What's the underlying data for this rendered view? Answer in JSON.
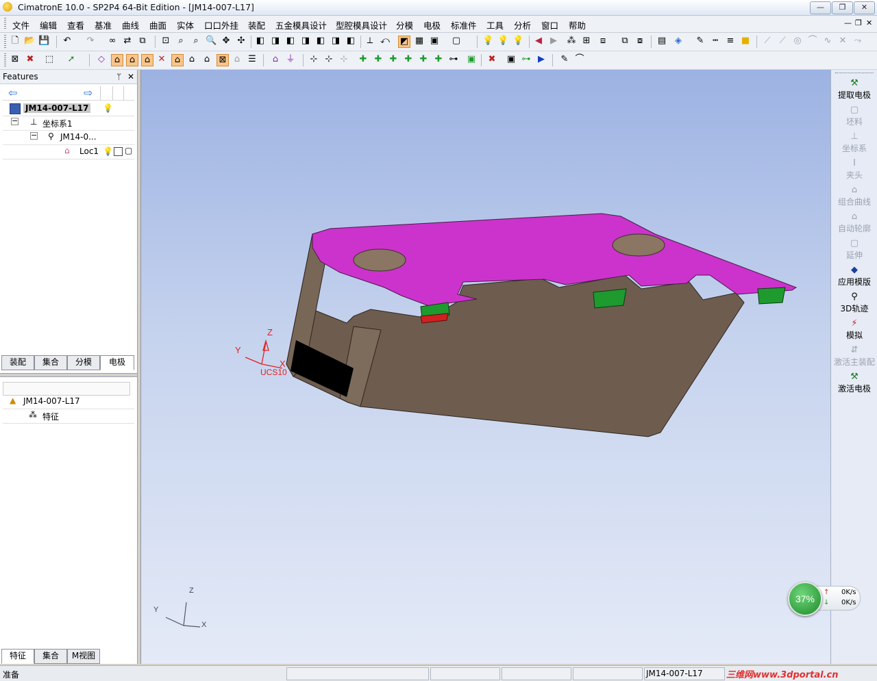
{
  "window": {
    "title": "CimatronE 10.0 - SP2P4 64-Bit Edition - [JM14-007-L17]",
    "minimize_glyph": "—",
    "restore_glyph": "❐",
    "close_glyph": "✕"
  },
  "menu": {
    "items": [
      "文件",
      "编辑",
      "查看",
      "基准",
      "曲线",
      "曲面",
      "实体",
      "口口外挂",
      "装配",
      "五金模具设计",
      "型腔模具设计",
      "分模",
      "电极",
      "标准件",
      "工具",
      "分析",
      "窗口",
      "帮助"
    ],
    "mdi_min": "—",
    "mdi_restore": "❐",
    "mdi_close": "✕"
  },
  "features_panel": {
    "title": "Features",
    "pin_glyph": "ᛘ",
    "close_glyph": "✕",
    "tree": [
      {
        "label": "JM14-007-L17",
        "expander": "",
        "icon": "part-icon"
      },
      {
        "label": "坐标系1",
        "expander": "−",
        "icon": "axes-icon"
      },
      {
        "label": "JM14-0...",
        "expander": "−",
        "icon": "component-icon"
      },
      {
        "label": "Loc1",
        "expander": "",
        "icon": "location-icon"
      }
    ],
    "upper_tabs": [
      "装配",
      "集合",
      "分模",
      "电极"
    ],
    "lower_tree": [
      {
        "label": "JM14-007-L17"
      },
      {
        "label": "特征"
      }
    ],
    "bottom_tabs": [
      "特征",
      "集合",
      "M视图"
    ]
  },
  "viewport": {
    "ucs_label": "UCS10",
    "axis_x": "X",
    "axis_y": "Y",
    "axis_z": "Z"
  },
  "right_panel": {
    "items": [
      {
        "label": "提取电极",
        "enabled": true
      },
      {
        "label": "坯料",
        "enabled": false
      },
      {
        "label": "坐标系",
        "enabled": false
      },
      {
        "label": "夹头",
        "enabled": false
      },
      {
        "label": "组合曲线",
        "enabled": false
      },
      {
        "label": "自动轮廓",
        "enabled": false
      },
      {
        "label": "延伸",
        "enabled": false
      },
      {
        "label": "应用模版",
        "enabled": true
      },
      {
        "label": "3D轨迹",
        "enabled": true
      },
      {
        "label": "模拟",
        "enabled": true
      },
      {
        "label": "激活主装配",
        "enabled": false
      },
      {
        "label": "激活电极",
        "enabled": true
      }
    ]
  },
  "status": {
    "left": "准备",
    "model": "JM14-007-L17"
  },
  "net_widget": {
    "percent": "37%",
    "up": "0K/s",
    "down": "0K/s",
    "up_arrow": "↑",
    "down_arrow": "↓"
  },
  "watermark": "三维网www.3dportal.cn",
  "colors": {
    "top_face": "#cc33cc",
    "side_face": "#6e5d4f",
    "accent_green": "#1f9a2e",
    "accent_red": "#d02020",
    "ucs_red": "#e02020"
  }
}
